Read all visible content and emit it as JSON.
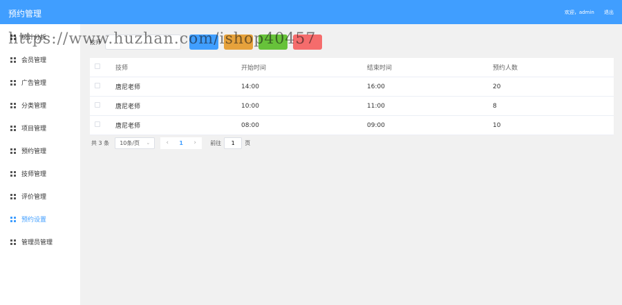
{
  "header": {
    "title": "预约管理",
    "welcome": "欢迎，admin",
    "logout": "退出"
  },
  "sidebar": {
    "items": [
      {
        "label": "统计分析",
        "icon": "grid-icon"
      },
      {
        "label": "会员管理",
        "icon": "grid-icon"
      },
      {
        "label": "广告管理",
        "icon": "grid-icon"
      },
      {
        "label": "分类管理",
        "icon": "grid-icon"
      },
      {
        "label": "项目管理",
        "icon": "grid-icon"
      },
      {
        "label": "预约管理",
        "icon": "grid-icon"
      },
      {
        "label": "技师管理",
        "icon": "grid-icon"
      },
      {
        "label": "评价管理",
        "icon": "grid-icon"
      },
      {
        "label": "预约设置",
        "icon": "grid-icon",
        "active": true
      },
      {
        "label": "管理员管理",
        "icon": "grid-icon"
      }
    ],
    "active_color": "#409eff"
  },
  "search": {
    "label": "技师",
    "placeholder": "",
    "buttons": {
      "search": "",
      "add": "",
      "edit": "",
      "delete": ""
    }
  },
  "table": {
    "columns": [
      "技师",
      "开始时间",
      "结束时间",
      "预约人数"
    ],
    "rows": [
      [
        "唐尼老师",
        "14:00",
        "16:00",
        "20"
      ],
      [
        "唐尼老师",
        "10:00",
        "11:00",
        "8"
      ],
      [
        "唐尼老师",
        "08:00",
        "09:00",
        "10"
      ]
    ]
  },
  "pagination": {
    "total": "共 3 条",
    "page_size": "10条/页",
    "current_page": "1",
    "goto_label": "前往",
    "goto_value": "1",
    "goto_suffix": "页"
  },
  "watermark": "https://www.huzhan.com/ishop40457",
  "colors": {
    "primary": "#409eff",
    "warning": "#e6a23c",
    "success": "#67c23a",
    "danger": "#f56c6c"
  }
}
